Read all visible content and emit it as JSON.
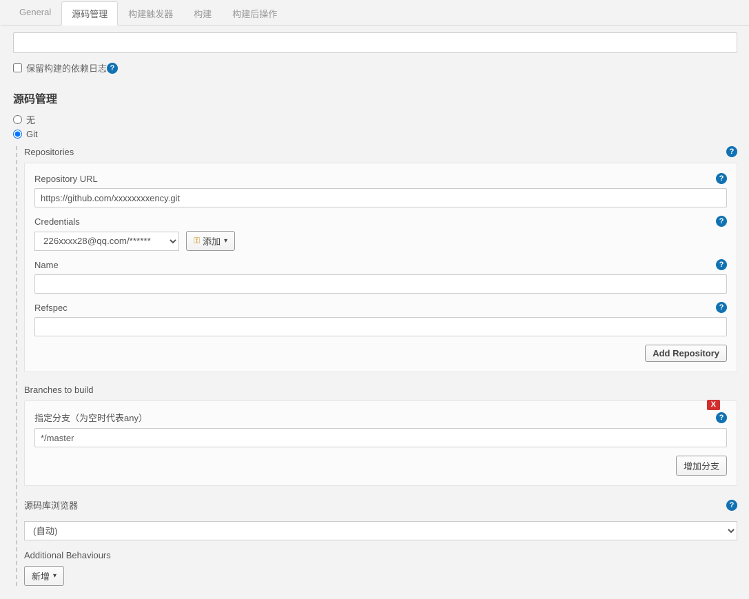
{
  "tabs": [
    {
      "key": "general",
      "label": "General"
    },
    {
      "key": "scm",
      "label": "源码管理"
    },
    {
      "key": "triggers",
      "label": "构建触发器"
    },
    {
      "key": "build",
      "label": "构建"
    },
    {
      "key": "postbuild",
      "label": "构建后操作"
    }
  ],
  "active_tab": "scm",
  "keep_deps_label": "保留构建的依赖日志",
  "section_title": "源码管理",
  "radio_none": "无",
  "radio_git": "Git",
  "repositories_label": "Repositories",
  "repo": {
    "url_label": "Repository URL",
    "url_value": "https://github.com/xxxxxxxxency.git",
    "cred_label": "Credentials",
    "cred_value": "226xxxx28@qq.com/******",
    "add_btn": "添加",
    "name_label": "Name",
    "name_value": "",
    "refspec_label": "Refspec",
    "refspec_value": "",
    "add_repo_btn": "Add Repository"
  },
  "branches": {
    "header": "Branches to build",
    "field_label": "指定分支（为空时代表any）",
    "value": "*/master",
    "add_btn": "增加分支",
    "delete": "X"
  },
  "browser": {
    "label": "源码库浏览器",
    "value": "(自动)"
  },
  "additional": {
    "label": "Additional Behaviours",
    "add_btn": "新增"
  }
}
